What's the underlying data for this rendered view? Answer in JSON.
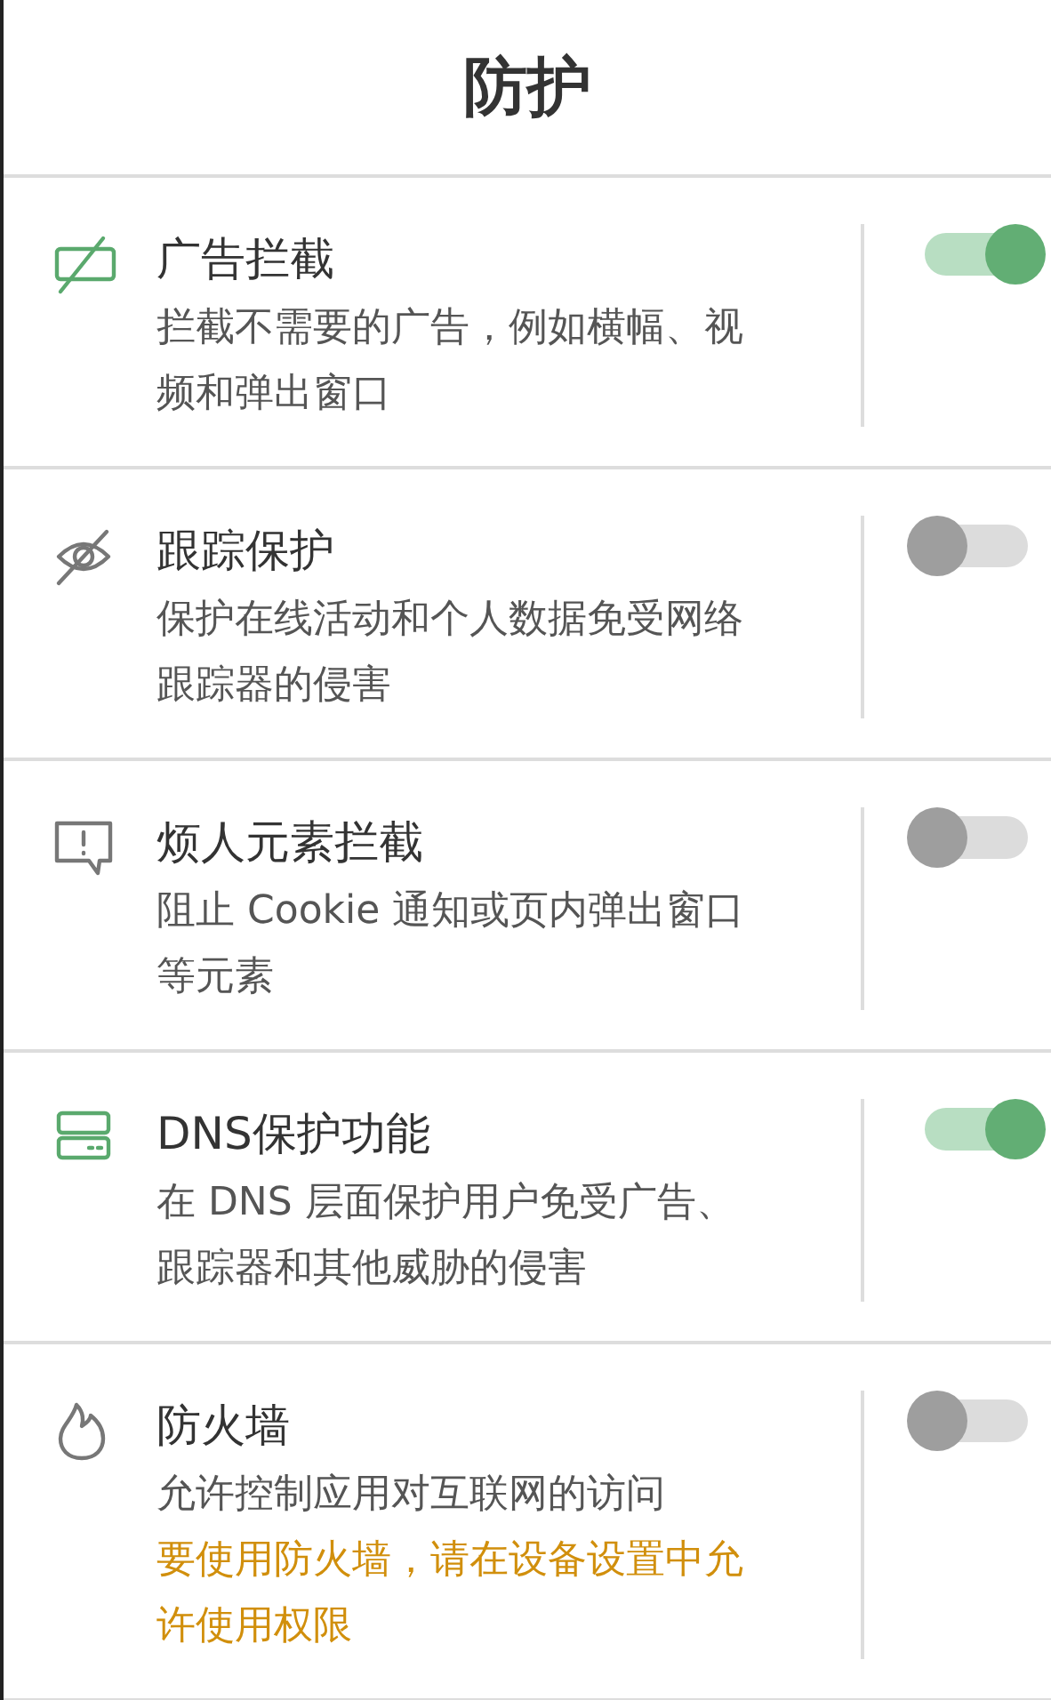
{
  "title": "防护",
  "features": [
    {
      "kind": "ads",
      "name": "广告拦截",
      "description": "拦截不需要的广告，例如横幅、视频和弹出窗口",
      "on": true
    },
    {
      "kind": "tracking",
      "name": "跟踪保护",
      "description": "保护在线活动和个人数据免受网络跟踪器的侵害",
      "on": false
    },
    {
      "kind": "annoyance",
      "name": "烦人元素拦截",
      "description": "阻止 Cookie 通知或页内弹出窗口等元素",
      "on": false
    },
    {
      "kind": "dns",
      "name": "DNS保护功能",
      "description": "在 DNS 层面保护用户免受广告、跟踪器和其他威胁的侵害",
      "on": true
    },
    {
      "kind": "firewall",
      "name": "防火墙",
      "description": "允许控制应用对互联网的访问",
      "warning": "要使用防火墙，请在设备设置中允许使用权限",
      "on": false
    }
  ]
}
